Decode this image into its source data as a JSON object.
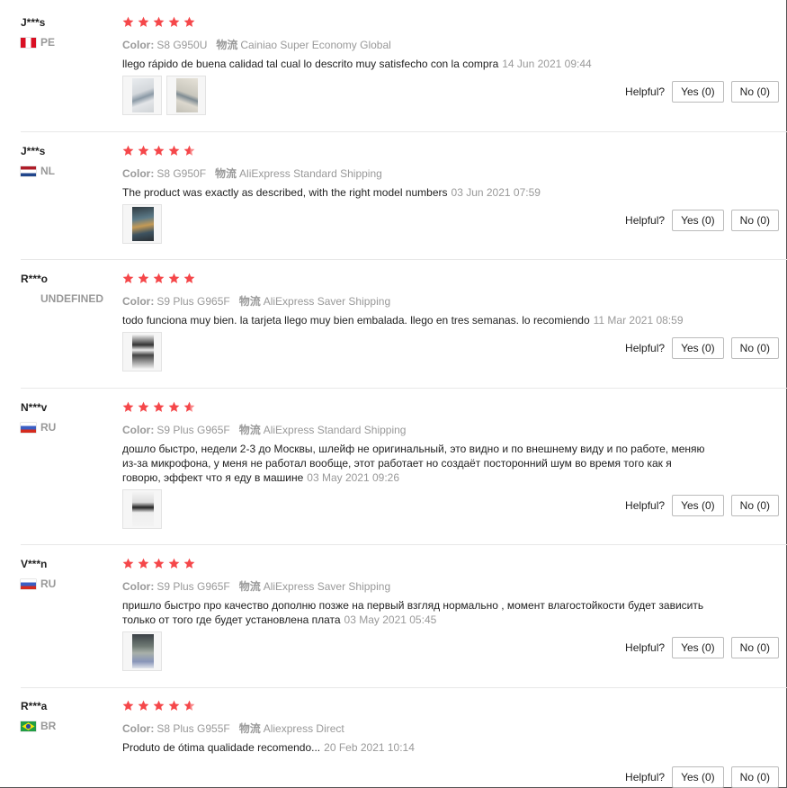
{
  "helpful_label": "Helpful?",
  "color_label": "Color:",
  "shipping_label": "物流",
  "star_color": "#f5474a",
  "reviews": [
    {
      "user": "J***s",
      "country": "PE",
      "flag": "pe",
      "rating": 5,
      "color": "S8 G950U",
      "shipping": "Cainiao Super Economy Global",
      "text": "llego rápido de buena calidad tal cual lo descrito muy satisfecho con la compra",
      "date": "14 Jun 2021 09:44",
      "photos": [
        "photo-1",
        "photo-2"
      ],
      "yes": "Yes (0)",
      "no": "No (0)"
    },
    {
      "user": "J***s",
      "country": "NL",
      "flag": "nl",
      "rating": 4.5,
      "color": "S8 G950F",
      "shipping": "AliExpress Standard Shipping",
      "text": "The product was exactly as described, with the right model numbers",
      "date": "03 Jun 2021 07:59",
      "photos": [
        "photo-1"
      ],
      "yes": "Yes (0)",
      "no": "No (0)"
    },
    {
      "user": "R***o",
      "country": "UNDEFINED",
      "flag": "",
      "rating": 5,
      "color": "S9 Plus G965F",
      "shipping": "AliExpress Saver Shipping",
      "text": "todo funciona muy bien. la tarjeta llego muy bien embalada. llego en tres semanas. lo recomiendo",
      "date": "11 Mar 2021 08:59",
      "photos": [
        "photo-1"
      ],
      "yes": "Yes (0)",
      "no": "No (0)"
    },
    {
      "user": "N***v",
      "country": "RU",
      "flag": "ru",
      "rating": 4.5,
      "color": "S9 Plus G965F",
      "shipping": "AliExpress Standard Shipping",
      "text": "дошло быстро, недели 2-3 до Москвы, шлейф не оригинальный, это видно и по внешнему виду и по работе, меняю из-за микрофона, у меня не работал вообще, этот работает но создаёт посторонний шум во время того как я говорю, эффект что я еду в машине",
      "date": "03 May 2021 09:26",
      "photos": [
        "photo-1"
      ],
      "yes": "Yes (0)",
      "no": "No (0)"
    },
    {
      "user": "V***n",
      "country": "RU",
      "flag": "ru",
      "rating": 5,
      "color": "S9 Plus G965F",
      "shipping": "AliExpress Saver Shipping",
      "text": "пришло быстро про качество дополню позже на первый взгляд нормально , момент влагостойкости будет зависить только от того где будет установлена плата",
      "date": "03 May 2021 05:45",
      "photos": [
        "photo-1"
      ],
      "yes": "Yes (0)",
      "no": "No (0)"
    },
    {
      "user": "R***a",
      "country": "BR",
      "flag": "br",
      "rating": 4.5,
      "color": "S8 Plus G955F",
      "shipping": "Aliexpress Direct",
      "text": "Produto de ótima qualidade recomendo...",
      "date": "20 Feb 2021 10:14",
      "photos": [],
      "yes": "Yes (0)",
      "no": "No (0)"
    }
  ]
}
